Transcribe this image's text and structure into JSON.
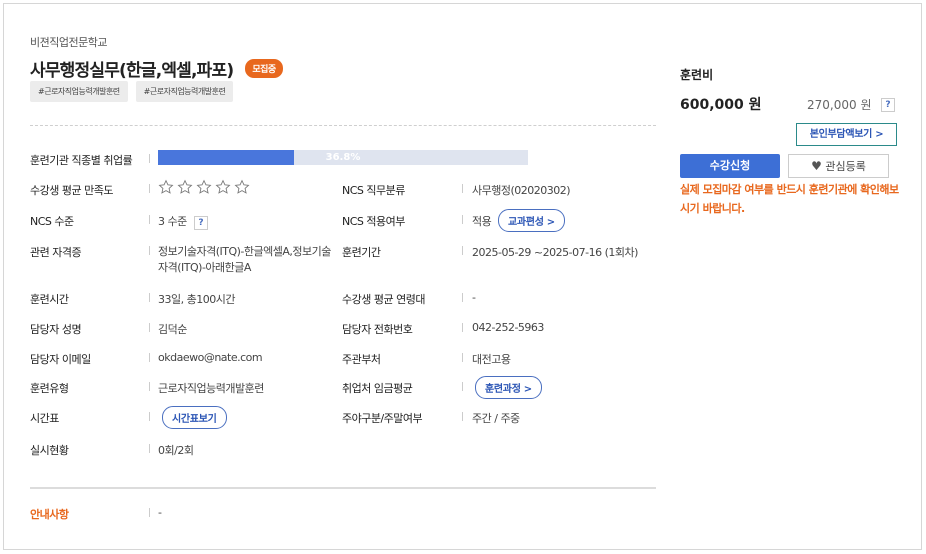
{
  "course": {
    "school": "비젼직업전문학교",
    "title": "사무행정실무(한글,엑셀,파포)",
    "status_badge": "모집중",
    "tags": [
      "#근로자직업능력개발훈련",
      "#근로자직업능력개발훈련"
    ]
  },
  "details": {
    "employment_rate": {
      "label": "훈련기관 직종별 취업률",
      "value": "36.8%",
      "fraction": 0.368
    },
    "satisfaction": {
      "label": "수강생 평균 만족도",
      "stars_total": 5,
      "stars_filled": 0
    },
    "ncs_field": {
      "label": "NCS 직무분류",
      "value": "사무행정(02020302)"
    },
    "ncs_level": {
      "label": "NCS 수준",
      "value": "3 수준",
      "help": "?"
    },
    "ncs_apply": {
      "label": "NCS 적용여부",
      "value": "적용",
      "button": "교과편성 >"
    },
    "certificates": {
      "label": "관련 자격증",
      "value": "정보기술자격(ITQ)-한글엑셀A,정보기술자격(ITQ)-아래한글A"
    },
    "period": {
      "label": "훈련기간",
      "value": "2025-05-29 ~2025-07-16 (1회차)"
    },
    "hours": {
      "label": "훈련시간",
      "value": "33일, 총100시간"
    },
    "age": {
      "label": "수강생 평균 연령대",
      "value": "-"
    },
    "manager": {
      "label": "담당자 성명",
      "value": "김덕순"
    },
    "phone": {
      "label": "담당자 전화번호",
      "value": "042-252-5963"
    },
    "email": {
      "label": "담당자 이메일",
      "value": "okdaewo@nate.com"
    },
    "dept": {
      "label": "주관부처",
      "value": "대전고용"
    },
    "type": {
      "label": "훈련유형",
      "value": "근로자직업능력개발훈련"
    },
    "wage": {
      "label": "취업처 임금평균",
      "button": "훈련과정 >"
    },
    "timetable": {
      "label": "시간표",
      "button": "시간표보기"
    },
    "daynight": {
      "label": "주야구분/주말여부",
      "value": "주간 / 주중"
    },
    "status": {
      "label": "실시현황",
      "value": "0회/2회"
    },
    "notice": {
      "label": "안내사항",
      "value": "-"
    }
  },
  "side": {
    "fee_label": "훈련비",
    "price": "600,000 원",
    "self_pay": "270,000 원",
    "help": "?",
    "burden_button": "본인부담액보기 >",
    "apply_button": "수강신청",
    "fav_button": "관심등록",
    "warning": "실제 모집마감 여부를 반드시 훈련기관에 확인해보시기 바랍니다."
  },
  "colors": {
    "accent": "#3d6fd6",
    "orange": "#e8681e"
  }
}
